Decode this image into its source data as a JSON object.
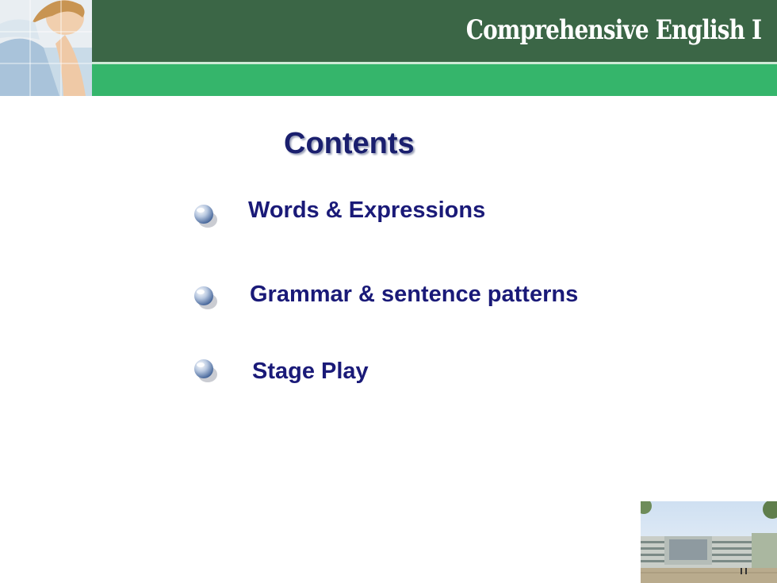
{
  "slide": {
    "course_title": "Comprehensive English I",
    "page_title": "Contents",
    "items": [
      {
        "label": "Words & Expressions"
      },
      {
        "label": "Grammar & sentence patterns"
      },
      {
        "label": "Stage Play"
      }
    ]
  },
  "colors": {
    "header_dark": "#3b6646",
    "header_green": "#35b56b",
    "title_navy": "#1a1f6e",
    "item_navy": "#1a1a78"
  },
  "icons": {
    "bullet": "glossy-bubble-icon"
  }
}
